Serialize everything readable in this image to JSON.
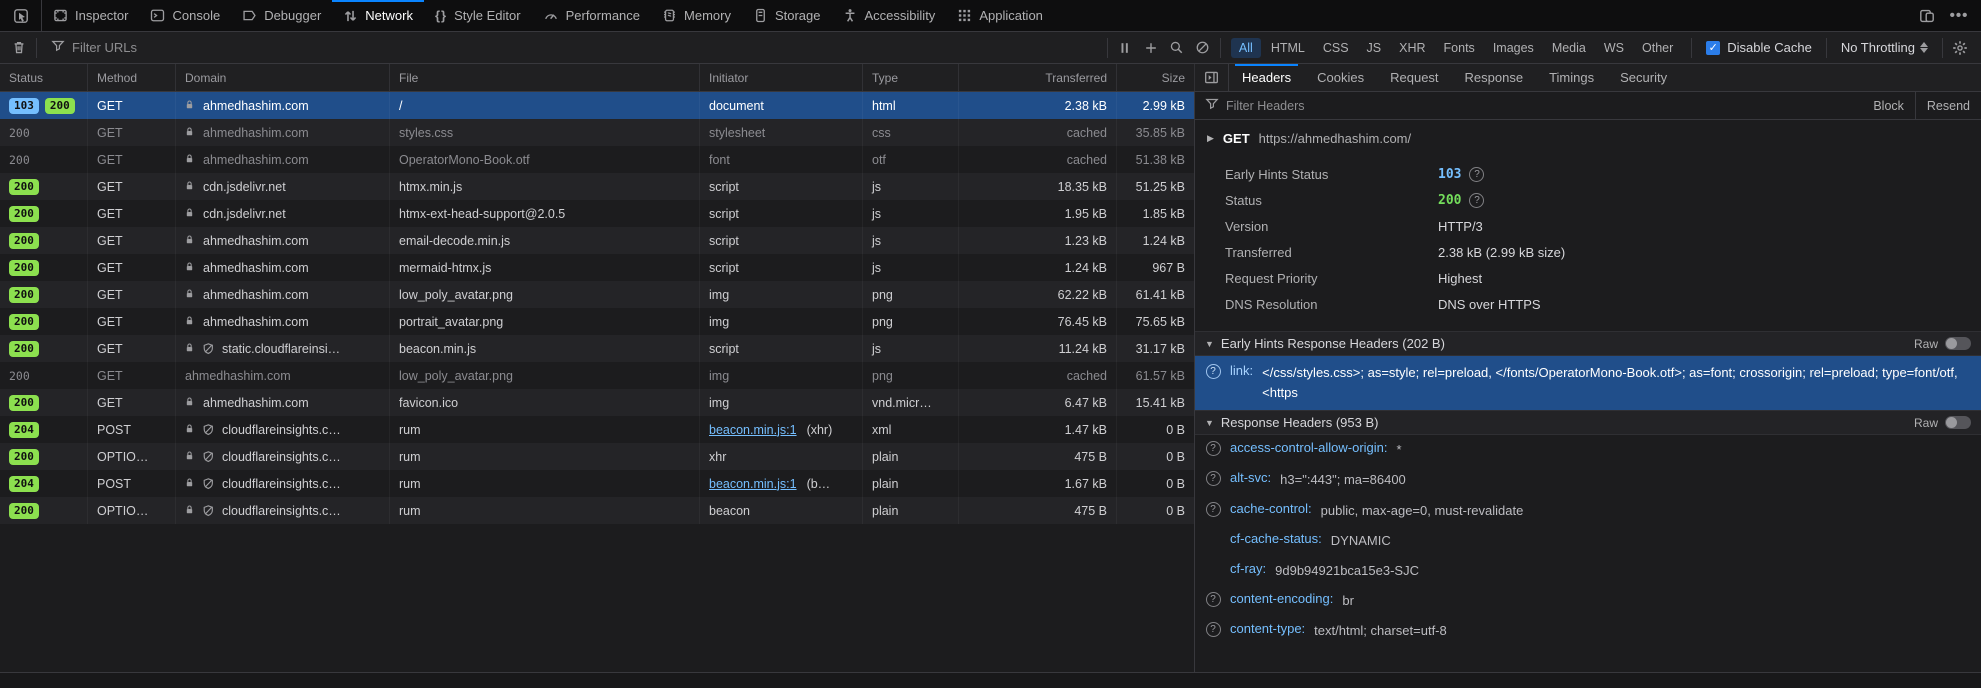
{
  "tabbar": {
    "pick_icon": "pick-element-icon",
    "tabs": [
      {
        "label": "Inspector",
        "icon": "inspector-icon"
      },
      {
        "label": "Console",
        "icon": "console-icon"
      },
      {
        "label": "Debugger",
        "icon": "debugger-icon"
      },
      {
        "label": "Network",
        "icon": "network-icon"
      },
      {
        "label": "Style Editor",
        "icon": "style-editor-icon"
      },
      {
        "label": "Performance",
        "icon": "performance-icon"
      },
      {
        "label": "Memory",
        "icon": "memory-icon"
      },
      {
        "label": "Storage",
        "icon": "storage-icon"
      },
      {
        "label": "Accessibility",
        "icon": "accessibility-icon"
      },
      {
        "label": "Application",
        "icon": "application-icon"
      }
    ],
    "active_tab": "Network",
    "right_icons": [
      "responsive-design-icon",
      "meatball-menu-icon"
    ]
  },
  "toolbar": {
    "clear_icon": "trash-icon",
    "filter_placeholder": "Filter URLs",
    "action_icons": [
      "pause-icon",
      "add-icon",
      "search-icon",
      "block-icon"
    ],
    "type_filters": [
      "All",
      "HTML",
      "CSS",
      "JS",
      "XHR",
      "Fonts",
      "Images",
      "Media",
      "WS",
      "Other"
    ],
    "active_filter": "All",
    "disable_cache_label": "Disable Cache",
    "disable_cache_checked": true,
    "throttling_label": "No Throttling",
    "settings_icon": "gear-icon"
  },
  "network_table": {
    "columns": [
      "Status",
      "Method",
      "Domain",
      "File",
      "Initiator",
      "Type",
      "Transferred",
      "Size"
    ],
    "rows": [
      {
        "badges": [
          {
            "text": "103",
            "style": "blue"
          },
          {
            "text": "200",
            "style": "green"
          }
        ],
        "method": "GET",
        "lock": true,
        "shield": false,
        "domain": "ahmedhashim.com",
        "file": "/",
        "initiator": "document",
        "type": "html",
        "transferred": "2.38 kB",
        "size": "2.99 kB",
        "selected": true,
        "dimmed": false
      },
      {
        "badges": [
          {
            "text": "200",
            "style": "plain"
          }
        ],
        "method": "GET",
        "lock": true,
        "shield": false,
        "domain": "ahmedhashim.com",
        "file": "styles.css",
        "initiator": "stylesheet",
        "type": "css",
        "transferred": "cached",
        "size": "35.85 kB",
        "selected": false,
        "dimmed": true
      },
      {
        "badges": [
          {
            "text": "200",
            "style": "plain"
          }
        ],
        "method": "GET",
        "lock": true,
        "shield": false,
        "domain": "ahmedhashim.com",
        "file": "OperatorMono-Book.otf",
        "initiator": "font",
        "type": "otf",
        "transferred": "cached",
        "size": "51.38 kB",
        "selected": false,
        "dimmed": true
      },
      {
        "badges": [
          {
            "text": "200",
            "style": "green"
          }
        ],
        "method": "GET",
        "lock": true,
        "shield": false,
        "domain": "cdn.jsdelivr.net",
        "file": "htmx.min.js",
        "initiator": "script",
        "type": "js",
        "transferred": "18.35 kB",
        "size": "51.25 kB",
        "selected": false,
        "dimmed": false
      },
      {
        "badges": [
          {
            "text": "200",
            "style": "green"
          }
        ],
        "method": "GET",
        "lock": true,
        "shield": false,
        "domain": "cdn.jsdelivr.net",
        "file": "htmx-ext-head-support@2.0.5",
        "initiator": "script",
        "type": "js",
        "transferred": "1.95 kB",
        "size": "1.85 kB",
        "selected": false,
        "dimmed": false
      },
      {
        "badges": [
          {
            "text": "200",
            "style": "green"
          }
        ],
        "method": "GET",
        "lock": true,
        "shield": false,
        "domain": "ahmedhashim.com",
        "file": "email-decode.min.js",
        "initiator": "script",
        "type": "js",
        "transferred": "1.23 kB",
        "size": "1.24 kB",
        "selected": false,
        "dimmed": false
      },
      {
        "badges": [
          {
            "text": "200",
            "style": "green"
          }
        ],
        "method": "GET",
        "lock": true,
        "shield": false,
        "domain": "ahmedhashim.com",
        "file": "mermaid-htmx.js",
        "initiator": "script",
        "type": "js",
        "transferred": "1.24 kB",
        "size": "967 B",
        "selected": false,
        "dimmed": false
      },
      {
        "badges": [
          {
            "text": "200",
            "style": "green"
          }
        ],
        "method": "GET",
        "lock": true,
        "shield": false,
        "domain": "ahmedhashim.com",
        "file": "low_poly_avatar.png",
        "initiator": "img",
        "type": "png",
        "transferred": "62.22 kB",
        "size": "61.41 kB",
        "selected": false,
        "dimmed": false
      },
      {
        "badges": [
          {
            "text": "200",
            "style": "green"
          }
        ],
        "method": "GET",
        "lock": true,
        "shield": false,
        "domain": "ahmedhashim.com",
        "file": "portrait_avatar.png",
        "initiator": "img",
        "type": "png",
        "transferred": "76.45 kB",
        "size": "75.65 kB",
        "selected": false,
        "dimmed": false
      },
      {
        "badges": [
          {
            "text": "200",
            "style": "green"
          }
        ],
        "method": "GET",
        "lock": true,
        "shield": true,
        "domain": "static.cloudflareinsi…",
        "file": "beacon.min.js",
        "initiator": "script",
        "type": "js",
        "transferred": "11.24 kB",
        "size": "31.17 kB",
        "selected": false,
        "dimmed": false
      },
      {
        "badges": [
          {
            "text": "200",
            "style": "plain"
          }
        ],
        "method": "GET",
        "lock": false,
        "shield": false,
        "domain": "ahmedhashim.com",
        "file": "low_poly_avatar.png",
        "initiator": "img",
        "type": "png",
        "transferred": "cached",
        "size": "61.57 kB",
        "selected": false,
        "dimmed": true
      },
      {
        "badges": [
          {
            "text": "200",
            "style": "green"
          }
        ],
        "method": "GET",
        "lock": true,
        "shield": false,
        "domain": "ahmedhashim.com",
        "file": "favicon.ico",
        "initiator": "img",
        "type": "vnd.micr…",
        "transferred": "6.47 kB",
        "size": "15.41 kB",
        "selected": false,
        "dimmed": false
      },
      {
        "badges": [
          {
            "text": "204",
            "style": "green"
          }
        ],
        "method": "POST",
        "lock": true,
        "shield": true,
        "domain": "cloudflareinsights.c…",
        "file": "rum",
        "initiator": "beacon.min.js:1",
        "initiator_link": true,
        "initiator_suffix": "(xhr)",
        "type": "xml",
        "transferred": "1.47 kB",
        "size": "0 B",
        "selected": false,
        "dimmed": false
      },
      {
        "badges": [
          {
            "text": "200",
            "style": "green"
          }
        ],
        "method": "OPTIO…",
        "lock": true,
        "shield": true,
        "domain": "cloudflareinsights.c…",
        "file": "rum",
        "initiator": "xhr",
        "type": "plain",
        "transferred": "475 B",
        "size": "0 B",
        "selected": false,
        "dimmed": false
      },
      {
        "badges": [
          {
            "text": "204",
            "style": "green"
          }
        ],
        "method": "POST",
        "lock": true,
        "shield": true,
        "domain": "cloudflareinsights.c…",
        "file": "rum",
        "initiator": "beacon.min.js:1",
        "initiator_link": true,
        "initiator_suffix": "(b…",
        "type": "plain",
        "transferred": "1.67 kB",
        "size": "0 B",
        "selected": false,
        "dimmed": false
      },
      {
        "badges": [
          {
            "text": "200",
            "style": "green"
          }
        ],
        "method": "OPTIO…",
        "lock": true,
        "shield": true,
        "domain": "cloudflareinsights.c…",
        "file": "rum",
        "initiator": "beacon",
        "type": "plain",
        "transferred": "475 B",
        "size": "0 B",
        "selected": false,
        "dimmed": false
      }
    ]
  },
  "details_panel": {
    "collapse_icon": "collapse-panel-icon",
    "tabs": [
      "Headers",
      "Cookies",
      "Request",
      "Response",
      "Timings",
      "Security"
    ],
    "active_tab": "Headers",
    "filter_placeholder": "Filter Headers",
    "block_label": "Block",
    "resend_label": "Resend",
    "request": {
      "method": "GET",
      "url": "https://ahmedhashim.com/"
    },
    "summary": [
      {
        "label": "Early Hints Status",
        "value": "103",
        "style": "status-blue",
        "help": true
      },
      {
        "label": "Status",
        "value": "200",
        "style": "status-green",
        "help": true
      },
      {
        "label": "Version",
        "value": "HTTP/3",
        "style": "",
        "help": false
      },
      {
        "label": "Transferred",
        "value": "2.38 kB (2.99 kB size)",
        "style": "",
        "help": false
      },
      {
        "label": "Request Priority",
        "value": "Highest",
        "style": "",
        "help": false
      },
      {
        "label": "DNS Resolution",
        "value": "DNS over HTTPS",
        "style": "",
        "help": false
      }
    ],
    "early_hints_section": {
      "title": "Early Hints Response Headers (202 B)",
      "raw_label": "Raw",
      "raw_on": false,
      "headers": [
        {
          "name": "link",
          "value": "</css/styles.css>; as=style; rel=preload, </fonts/OperatorMono-Book.otf>; as=font; crossorigin; rel=preload; type=font/otf, <https",
          "help": true,
          "selected": true
        }
      ]
    },
    "response_section": {
      "title": "Response Headers (953 B)",
      "raw_label": "Raw",
      "raw_on": false,
      "headers": [
        {
          "name": "access-control-allow-origin",
          "value": "*",
          "help": true,
          "selected": false
        },
        {
          "name": "alt-svc",
          "value": "h3=\":443\"; ma=86400",
          "help": true,
          "selected": false
        },
        {
          "name": "cache-control",
          "value": "public, max-age=0, must-revalidate",
          "help": true,
          "selected": false
        },
        {
          "name": "cf-cache-status",
          "value": "DYNAMIC",
          "help": false,
          "selected": false
        },
        {
          "name": "cf-ray",
          "value": "9d9b94921bca15e3-SJC",
          "help": false,
          "selected": false
        },
        {
          "name": "content-encoding",
          "value": "br",
          "help": true,
          "selected": false
        },
        {
          "name": "content-type",
          "value": "text/html; charset=utf-8",
          "help": true,
          "selected": false
        }
      ]
    }
  },
  "colors": {
    "accent": "#0a84ff",
    "selection": "#204e8a",
    "status_green": "#8ce04f",
    "status_blue": "#75bfff",
    "link": "#75bfff",
    "summary_green": "#74de5c"
  }
}
